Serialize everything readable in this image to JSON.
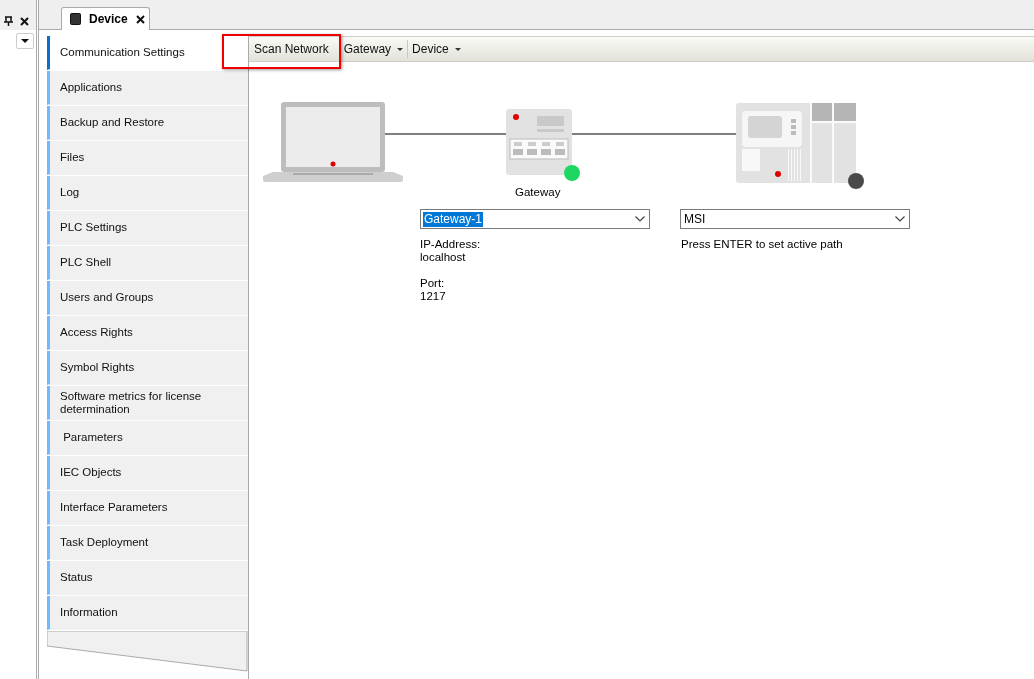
{
  "tabs": [
    {
      "label": "Device",
      "selected": true
    }
  ],
  "sidebar": {
    "items": [
      {
        "label": "Communication Settings",
        "selected": true
      },
      {
        "label": "Applications",
        "selected": false
      },
      {
        "label": "Backup and Restore",
        "selected": false
      },
      {
        "label": "Files",
        "selected": false
      },
      {
        "label": "Log",
        "selected": false
      },
      {
        "label": "PLC Settings",
        "selected": false
      },
      {
        "label": "PLC Shell",
        "selected": false
      },
      {
        "label": "Users and Groups",
        "selected": false
      },
      {
        "label": "Access Rights",
        "selected": false
      },
      {
        "label": "Symbol Rights",
        "selected": false
      },
      {
        "label": "Software metrics for license determination",
        "selected": false
      },
      {
        "label": " Parameters",
        "selected": false
      },
      {
        "label": "IEC Objects",
        "selected": false
      },
      {
        "label": "Interface Parameters",
        "selected": false
      },
      {
        "label": "Task Deployment",
        "selected": false
      },
      {
        "label": "Status",
        "selected": false
      },
      {
        "label": "Information",
        "selected": false
      }
    ]
  },
  "toolbar": [
    {
      "label": "Scan Network",
      "kind": "button",
      "highlighted": true
    },
    {
      "label": "Gateway",
      "kind": "menu",
      "highlighted": false
    },
    {
      "label": "Device",
      "kind": "menu",
      "highlighted": false
    }
  ],
  "diagram": {
    "nodes": [
      {
        "kind": "computer"
      },
      {
        "kind": "gateway",
        "label": "Gateway",
        "color": "#1ed760"
      },
      {
        "kind": "device",
        "color": "#4a4a4a"
      }
    ],
    "gateway_select": {
      "value": "Gateway-1",
      "text_selected": true
    },
    "gateway_info": [
      {
        "label": "IP-Address:",
        "value": "localhost"
      },
      {
        "label": "Port:",
        "value": "1217"
      }
    ],
    "device_select": {
      "value": "MSI",
      "text_selected": false
    },
    "device_hint": "Press ENTER to set active path"
  }
}
